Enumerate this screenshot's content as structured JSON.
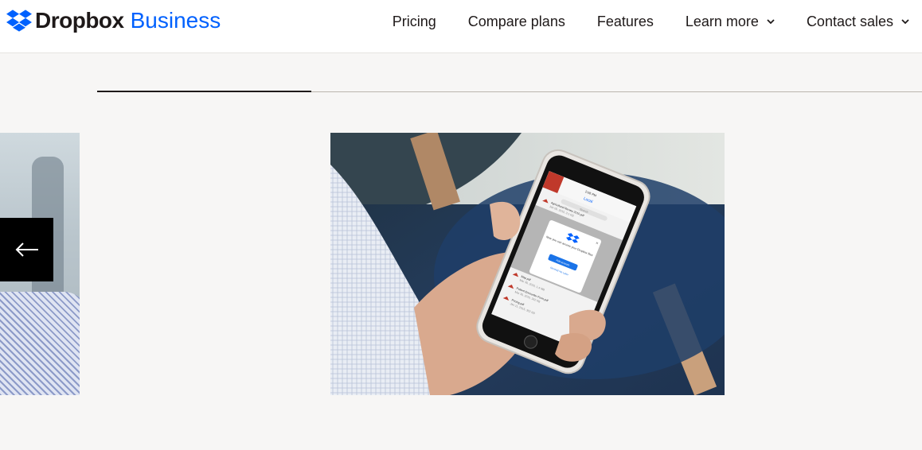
{
  "brand": {
    "name": "Dropbox",
    "product": "Business",
    "accent": "#0061fe"
  },
  "nav": {
    "items": [
      {
        "label": "Pricing",
        "dropdown": false
      },
      {
        "label": "Compare plans",
        "dropdown": false
      },
      {
        "label": "Features",
        "dropdown": false
      },
      {
        "label": "Learn more",
        "dropdown": true
      },
      {
        "label": "Contact sales",
        "dropdown": true
      }
    ]
  },
  "carousel": {
    "progress": 0.26,
    "prev_icon": "arrow-left-icon",
    "phone": {
      "status_time": "2:06 PM",
      "folder": "Local",
      "search_placeholder": "Search",
      "files": [
        {
          "name": "Agricultural Review 2015.pdf",
          "meta": "Jan 05, 2015, 3.1 KB"
        },
        {
          "name": "Map.pdf",
          "meta": "Mar 30, 2015, 1.4 MB"
        },
        {
          "name": "Patient Encounter Form.pdf",
          "meta": "Mar 30, 2015, 362 KB"
        },
        {
          "name": "Pricing.pdf",
          "meta": "Jan 11, 2015, 352 KB"
        }
      ],
      "popup": {
        "message": "Now you can access your Dropbox files",
        "primary": "Add account",
        "secondary": "Remind me Later"
      }
    }
  }
}
